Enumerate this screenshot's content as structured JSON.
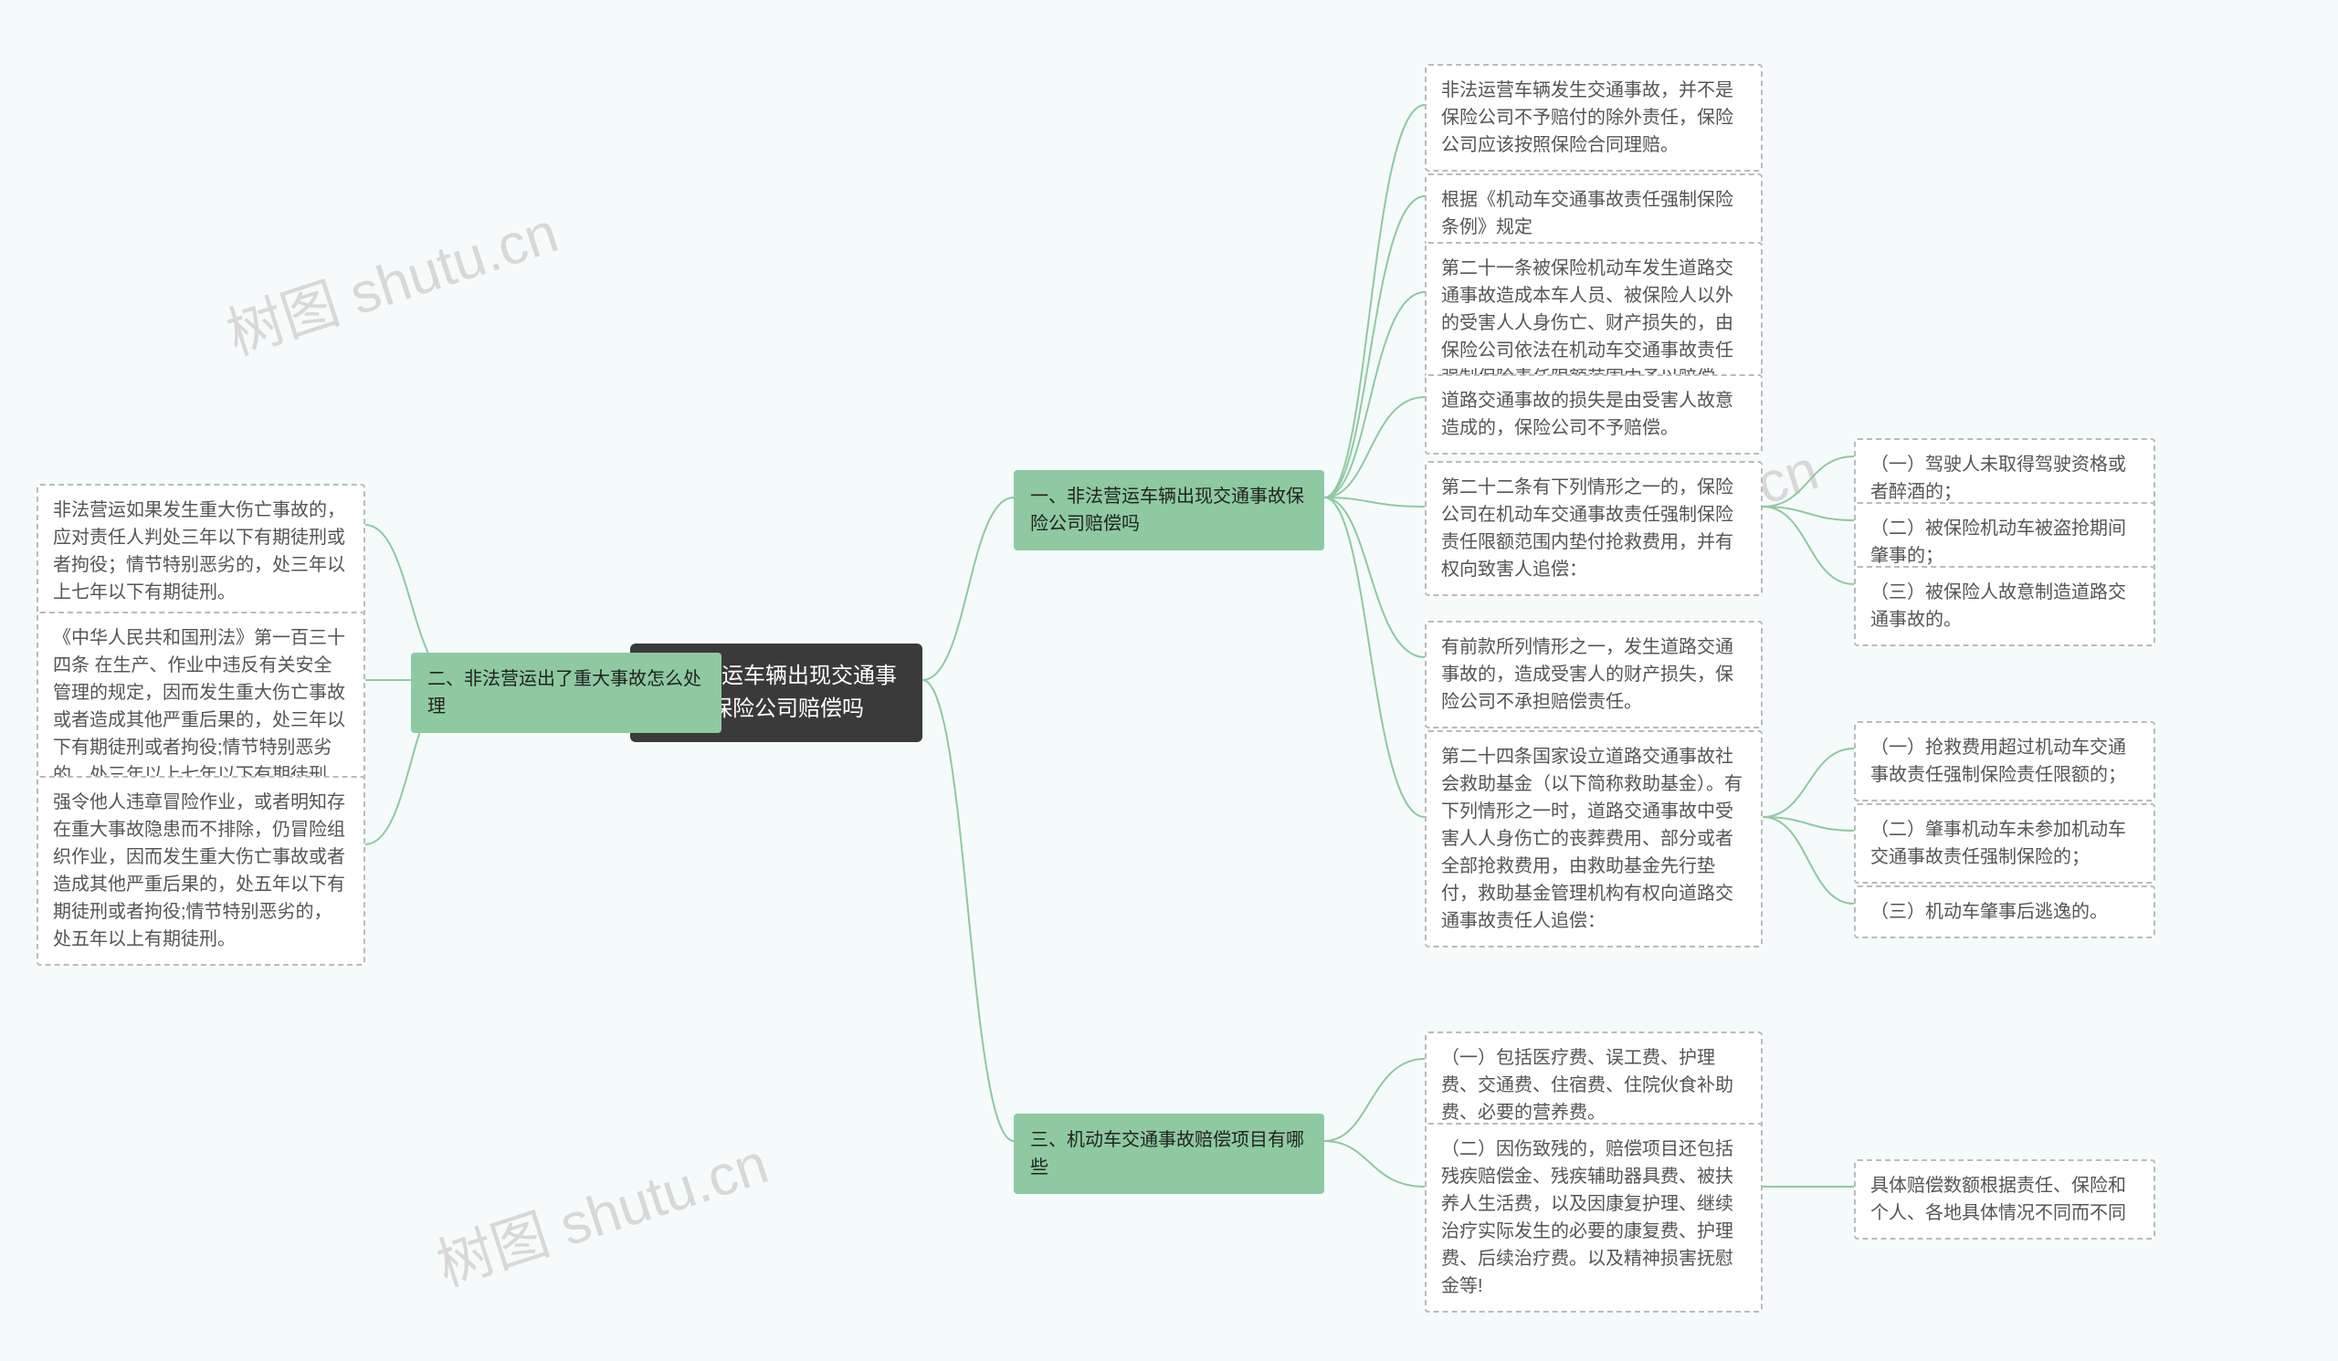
{
  "watermark": "树图 shutu.cn",
  "root": "非法营运车辆出现交通事故保险公司赔偿吗",
  "branch1": "一、非法营运车辆出现交通事故保险公司赔偿吗",
  "branch2": "二、非法营运出了重大事故怎么处理",
  "branch3": "三、机动车交通事故赔偿项目有哪些",
  "b1": {
    "n1": "非法运营车辆发生交通事故，并不是保险公司不予赔付的除外责任，保险公司应该按照保险合同理赔。",
    "n2": "根据《机动车交通事故责任强制保险条例》规定",
    "n3": "第二十一条被保险机动车发生道路交通事故造成本车人员、被保险人以外的受害人人身伤亡、财产损失的，由保险公司依法在机动车交通事故责任强制保险责任限额范围内予以赔偿。",
    "n4": "道路交通事故的损失是由受害人故意造成的，保险公司不予赔偿。",
    "n5": "第二十二条有下列情形之一的，保险公司在机动车交通事故责任强制保险责任限额范围内垫付抢救费用，并有权向致害人追偿：",
    "n5a": "（一）驾驶人未取得驾驶资格或者醉酒的；",
    "n5b": "（二）被保险机动车被盗抢期间肇事的；",
    "n5c": "（三）被保险人故意制造道路交通事故的。",
    "n6": "有前款所列情形之一，发生道路交通事故的，造成受害人的财产损失，保险公司不承担赔偿责任。",
    "n7": "第二十四条国家设立道路交通事故社会救助基金（以下简称救助基金）。有下列情形之一时，道路交通事故中受害人人身伤亡的丧葬费用、部分或者全部抢救费用，由救助基金先行垫付，救助基金管理机构有权向道路交通事故责任人追偿：",
    "n7a": "（一）抢救费用超过机动车交通事故责任强制保险责任限额的；",
    "n7b": "（二）肇事机动车未参加机动车交通事故责任强制保险的；",
    "n7c": "（三）机动车肇事后逃逸的。"
  },
  "b2": {
    "n1": "非法营运如果发生重大伤亡事故的，应对责任人判处三年以下有期徒刑或者拘役；情节特别恶劣的，处三年以上七年以下有期徒刑。",
    "n2": "《中华人民共和国刑法》第一百三十四条 在生产、作业中违反有关安全管理的规定，因而发生重大伤亡事故或者造成其他严重后果的，处三年以下有期徒刑或者拘役;情节特别恶劣的，处三年以上七年以下有期徒刑。",
    "n3": "强令他人违章冒险作业，或者明知存在重大事故隐患而不排除，仍冒险组织作业，因而发生重大伤亡事故或者造成其他严重后果的，处五年以下有期徒刑或者拘役;情节特别恶劣的，处五年以上有期徒刑。"
  },
  "b3": {
    "n1": "（一）包括医疗费、误工费、护理费、交通费、住宿费、住院伙食补助费、必要的营养费。",
    "n2": "（二）因伤致残的，赔偿项目还包括残疾赔偿金、残疾辅助器具费、被扶养人生活费，以及因康复护理、继续治疗实际发生的必要的康复费、护理费、后续治疗费。以及精神损害抚慰金等!",
    "n2a": "具体赔偿数额根据责任、保险和个人、各地具体情况不同而不同"
  }
}
